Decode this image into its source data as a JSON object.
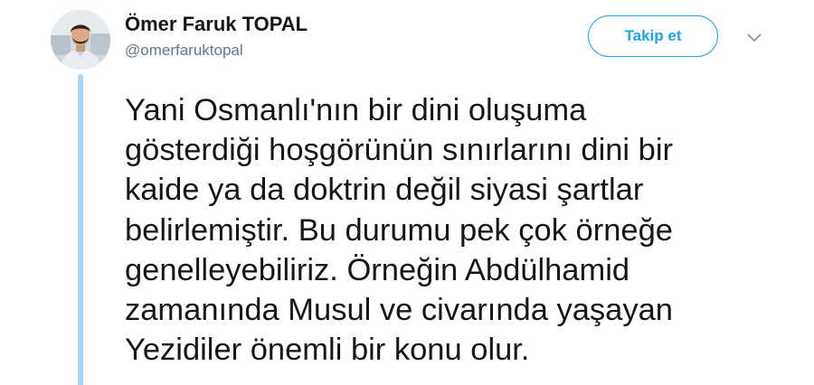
{
  "tweet": {
    "author": {
      "name": "Ömer Faruk TOPAL",
      "handle": "@omerfaruktopal",
      "avatar_icon": "profile-photo"
    },
    "follow_label": "Takip et",
    "menu_icon": "chevron-down-icon",
    "text_lines": [
      "Yani Osmanlı'nın bir dini oluşuma",
      "gösterdiği hoşgörünün sınırlarını dini bir",
      "kaide ya da doktrin değil siyasi şartlar",
      "belirlemiştir. Bu durumu pek çok örneğe",
      "genelleyebiliriz. Örneğin Abdülhamid",
      "zamanında Musul ve civarında yaşayan",
      "Yezidiler önemli bir konu olur."
    ]
  },
  "colors": {
    "accent": "#1da1f2",
    "thread_line": "#a9d6f3",
    "text_primary": "#14171a",
    "text_secondary": "#657786"
  }
}
